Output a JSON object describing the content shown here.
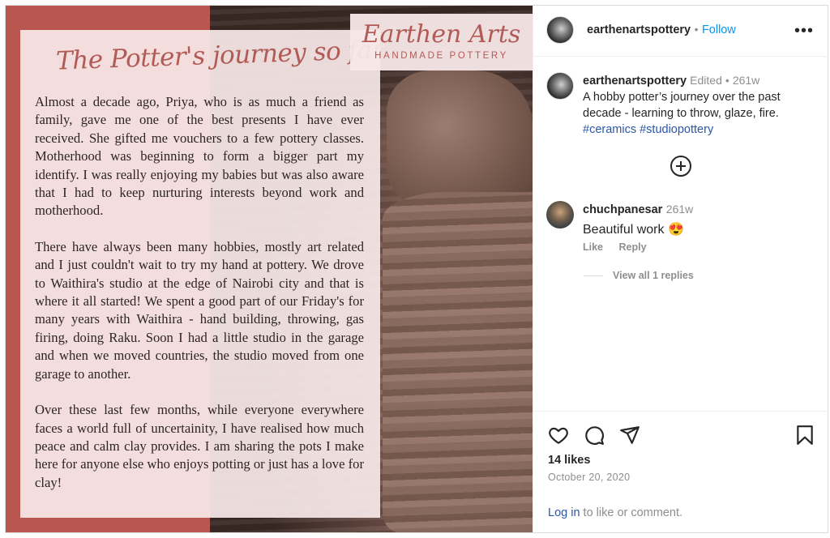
{
  "post_image": {
    "title_script": "The Potter's journey so far.....",
    "brand": {
      "name": "Earthen Arts",
      "tagline": "HANDMADE POTTERY"
    },
    "paragraphs": [
      "Almost a decade ago, Priya, who is as much a friend as family, gave me one of the best presents I have ever received. She gifted me vouchers to a few pottery classes. Motherhood was beginning to form a bigger part my identify. I was really enjoying my babies but was also aware that I had to keep nurturing interests beyond work and motherhood.",
      "There have always been many hobbies, mostly art related and I just couldn't wait to try my hand at pottery. We drove to Waithira's studio at the edge of Nairobi city and that is where it all started! We spent a good part of our Friday's for many years with Waithira - hand building, throwing, gas firing, doing Raku. Soon I had a little studio in the garage and when we moved countries, the studio moved from one garage to another.",
      "Over these last few months, while everyone everywhere faces a world full of uncertainity, I have realised how much peace and calm clay provides. I am sharing the pots I make here for anyone else who enjoys potting or just has a love for clay!"
    ]
  },
  "header": {
    "username": "earthenartspottery",
    "separator": "•",
    "follow_label": "Follow",
    "more_icon": "more-options-icon"
  },
  "caption": {
    "username": "earthenartspottery",
    "edited": "Edited",
    "separator": "•",
    "age": "261w",
    "text": "A hobby potter’s journey over the past decade - learning to throw, glaze, fire.",
    "hashtags": [
      "#ceramics",
      "#studiopottery"
    ]
  },
  "comment": {
    "username": "chuchpanesar",
    "age": "261w",
    "text": "Beautiful work 😍",
    "like_label": "Like",
    "reply_label": "Reply",
    "view_replies": "View all 1 replies"
  },
  "actions": {
    "likes": "14 likes",
    "date": "October 20, 2020",
    "login_link": "Log in",
    "login_rest": " to like or comment."
  }
}
